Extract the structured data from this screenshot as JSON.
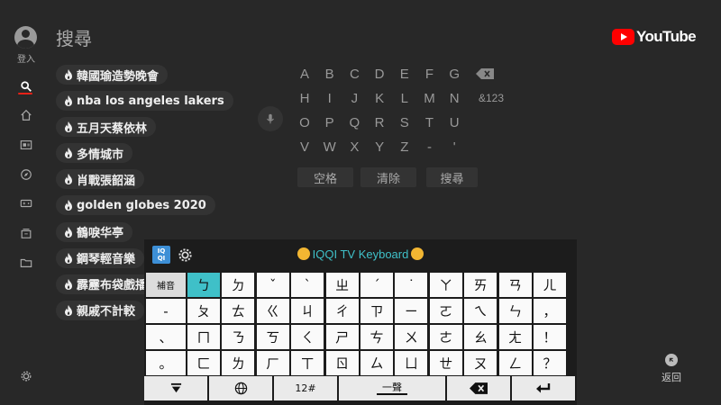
{
  "header": {
    "title": "搜尋",
    "brand": "YouTube"
  },
  "rail": {
    "signin_label": "登入",
    "items": [
      "search-icon",
      "home-icon",
      "subscriptions-icon",
      "explore-icon",
      "gaming-icon",
      "library-icon",
      "folder-icon"
    ],
    "settings": "gear-icon"
  },
  "suggestions": [
    "韓國瑜造勢晚會",
    "nba los angeles lakers",
    "五月天蔡依林",
    "多情城市",
    "肖戰張韶涵",
    "golden globes 2020",
    "鶴唳华亭",
    "鋼琴輕音樂",
    "霹靂布袋戲播",
    "親戚不計較"
  ],
  "letters": {
    "rows": [
      [
        "A",
        "B",
        "C",
        "D",
        "E",
        "F",
        "G"
      ],
      [
        "H",
        "I",
        "J",
        "K",
        "L",
        "M",
        "N"
      ],
      [
        "O",
        "P",
        "Q",
        "R",
        "S",
        "T",
        "U"
      ],
      [
        "V",
        "W",
        "X",
        "Y",
        "Z",
        "-",
        "'"
      ]
    ],
    "numbers_label": "&123",
    "space_label": "空格",
    "clear_label": "清除",
    "search_label": "搜尋"
  },
  "keyboard": {
    "logo": "IQQI",
    "title": "IQQI TV Keyboard",
    "fn_key": "補音",
    "rows": [
      [
        "ㄅ",
        "ㄉ",
        "ˇ",
        "ˋ",
        "ㄓ",
        "ˊ",
        "˙",
        "ㄚ",
        "ㄞ",
        "ㄢ",
        "ㄦ"
      ],
      [
        "ㄆ",
        "ㄊ",
        "ㄍ",
        "ㄐ",
        "ㄔ",
        "ㄗ",
        "ㄧ",
        "ㄛ",
        "ㄟ",
        "ㄣ",
        "，"
      ],
      [
        "ㄇ",
        "ㄋ",
        "ㄎ",
        "ㄑ",
        "ㄕ",
        "ㄘ",
        "ㄨ",
        "ㄜ",
        "ㄠ",
        "ㄤ",
        "！"
      ],
      [
        "ㄈ",
        "ㄌ",
        "ㄏ",
        "ㄒ",
        "ㄖ",
        "ㄙ",
        "ㄩ",
        "ㄝ",
        "ㄡ",
        "ㄥ",
        "？"
      ]
    ],
    "left_col": [
      "-",
      "、",
      "。"
    ],
    "active_key": "ㄅ",
    "bottom": {
      "symbols": "12#",
      "space": "一聲"
    }
  },
  "back_label": "返回"
}
